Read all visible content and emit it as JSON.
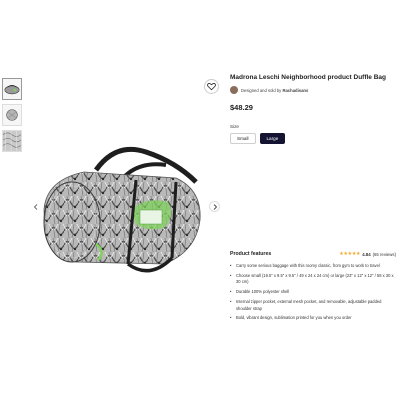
{
  "product": {
    "title": "Madrona Leschi Neighborhood product Duffle Bag",
    "designed_by_prefix": "Designed and sold by",
    "designer": "Rachadisans",
    "price": "$48.29",
    "size_label": "Size",
    "sizes": [
      "Small",
      "Large"
    ],
    "selected_size": "Large"
  },
  "gallery": {
    "thumbnail_count": 3,
    "active_thumbnail": 0
  },
  "features": {
    "title": "Product features",
    "rating": "4.84",
    "reviews": "(65 reviews)",
    "star_count": 5,
    "items": [
      "Carry some serious baggage with this roomy classic, from gym to work to travel",
      "Choose small (19.5\" x 9.5\" x 9.5\" / 49 x 24 x 24 cm) or large (23\" x 12\" x 12\" / 58 x 30 x 30 cm)",
      "Durable 100% polyester shell",
      "Internal zipper pocket, external mesh pocket, and removable, adjustable padded shoulder strap",
      "Bold, vibrant design, sublimation printed for you when you order"
    ]
  },
  "icons": {
    "favorite": "heart-icon",
    "prev": "chevron-left-icon",
    "next": "chevron-right-icon"
  },
  "colors": {
    "selected_size_bg": "#141432",
    "star": "#f5a623"
  }
}
